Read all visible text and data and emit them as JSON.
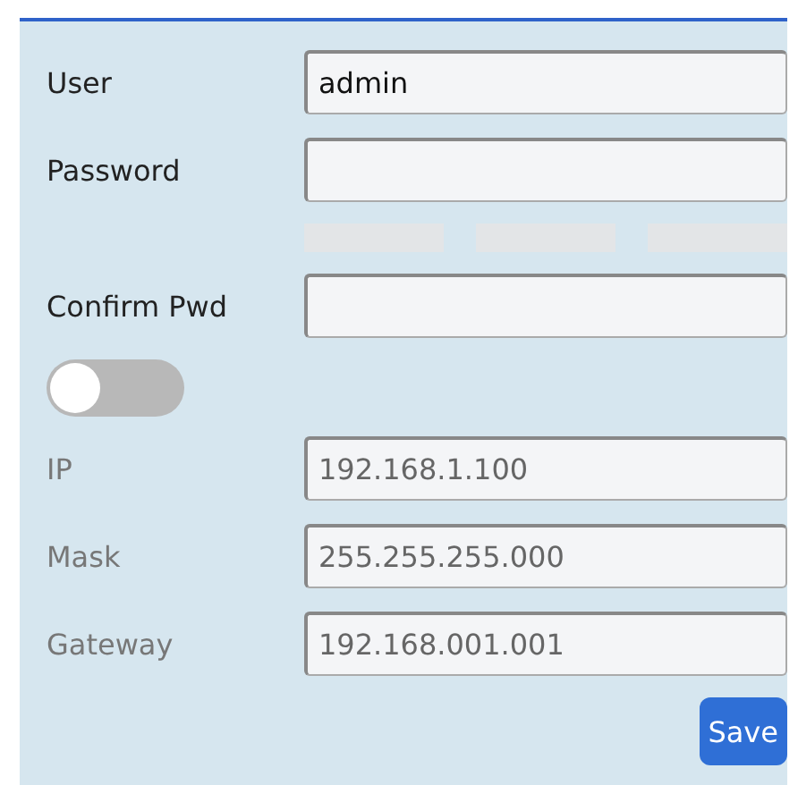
{
  "account_fields": [
    {
      "label": "User",
      "value": "admin"
    },
    {
      "label": "Password"
    },
    {
      "label": "Confirm Pwd"
    }
  ],
  "strength_segments": [
    {
      "on": false
    },
    {
      "on": false
    },
    {
      "on": false
    }
  ],
  "dhcp_toggle": {
    "on": false
  },
  "network_fields": [
    {
      "label": "IP",
      "value": "192.168.1.100",
      "disabled": true
    },
    {
      "label": "Mask",
      "value": "255.255.255.000",
      "disabled": true
    },
    {
      "label": "Gateway",
      "value": "192.168.001.001",
      "disabled": true
    }
  ],
  "save_button": {
    "label": "Save"
  }
}
